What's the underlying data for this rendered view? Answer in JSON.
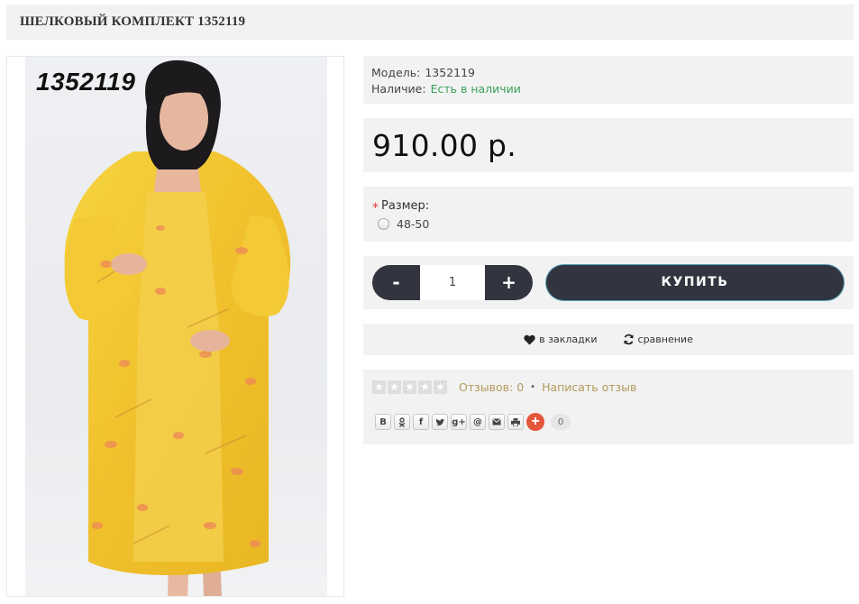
{
  "product": {
    "title": "ШЕЛКОВЫЙ КОМПЛЕКТ 1352119",
    "image_code": "1352119"
  },
  "info": {
    "model_label": "Модель:",
    "model_value": "1352119",
    "stock_label": "Наличие:",
    "stock_value": "Есть в наличии",
    "stock_color": "#3aa05a"
  },
  "price": "910.00 р.",
  "options": {
    "required_mark": "*",
    "size_label": "Размер:",
    "size_values": [
      "48-50"
    ],
    "selected": false
  },
  "cart": {
    "minus": "-",
    "quantity": "1",
    "plus": "+",
    "buy_label": "КУПИТЬ"
  },
  "links": {
    "bookmark_label": "в закладки",
    "bookmark_icon": "heart-icon",
    "compare_label": "сравнение",
    "compare_icon": "refresh-icon"
  },
  "reviews": {
    "stars_filled": 0,
    "stars_total": 5,
    "count_label": "Отзывов: 0",
    "separator": "•",
    "write_label": "Написать отзыв",
    "link_color": "#b39a5a"
  },
  "share": {
    "buttons": [
      "В",
      "ok",
      "f",
      "twitter",
      "g+",
      "@",
      "mail",
      "print"
    ],
    "plus": "+",
    "count": "0"
  },
  "colors": {
    "panel_bg": "#f2f2f2",
    "button_dark": "#32353f",
    "share_plus": "#e4573b"
  }
}
